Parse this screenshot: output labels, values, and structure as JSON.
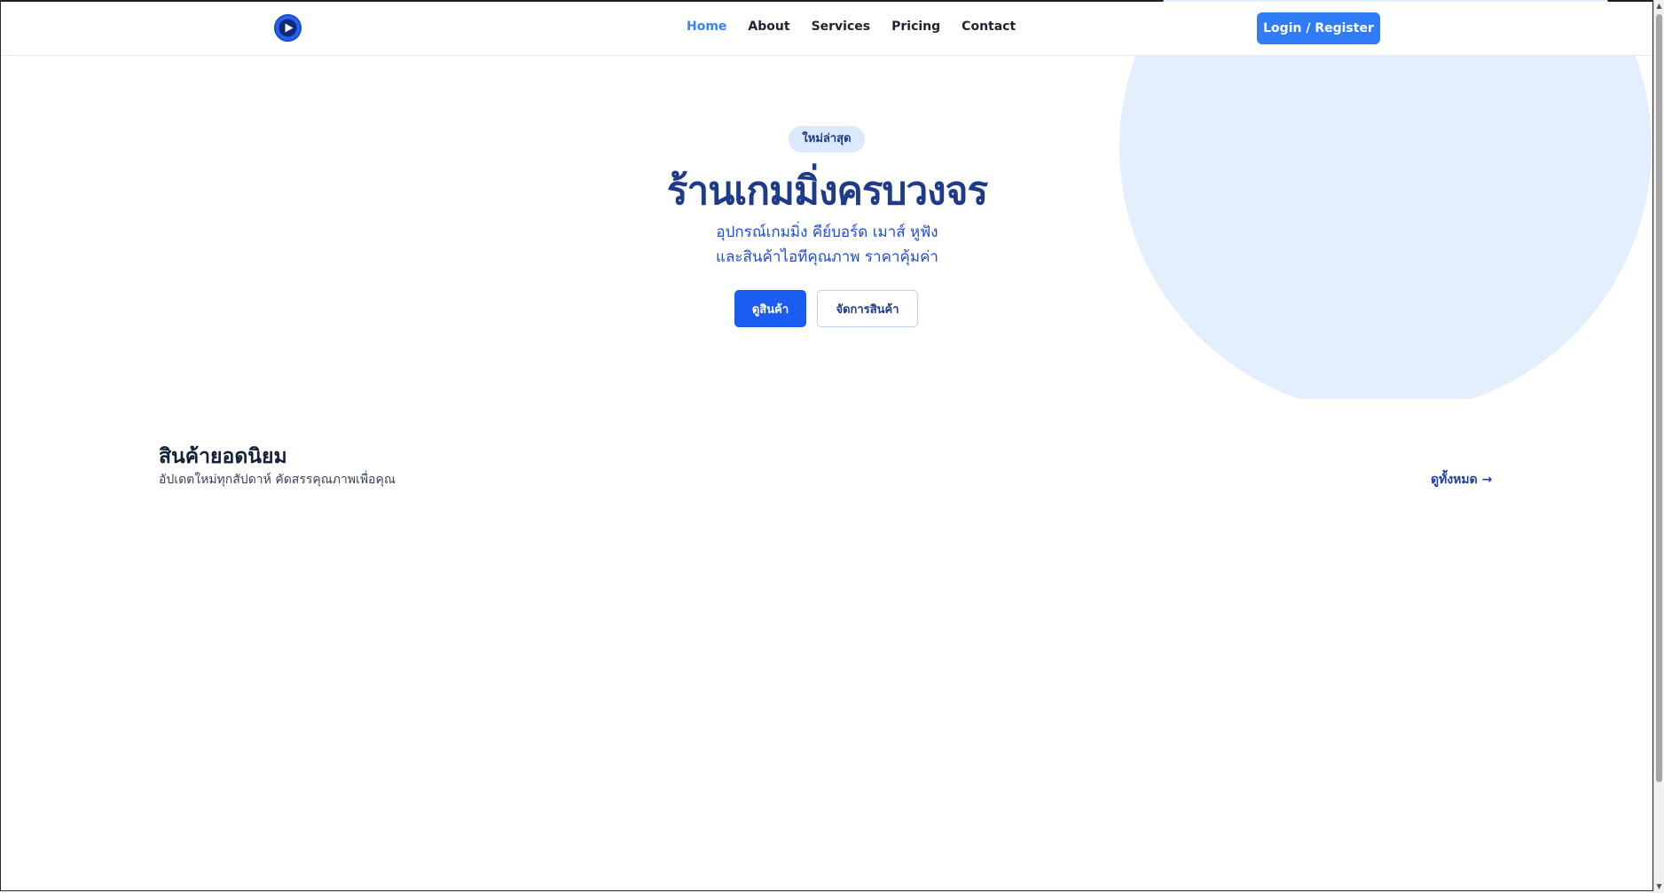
{
  "header": {
    "logo_icon": "play-circle-icon",
    "nav": [
      {
        "label": "Home",
        "active": true
      },
      {
        "label": "About",
        "active": false
      },
      {
        "label": "Services",
        "active": false
      },
      {
        "label": "Pricing",
        "active": false
      },
      {
        "label": "Contact",
        "active": false
      }
    ],
    "login_label": "Login / Register"
  },
  "hero": {
    "badge": "ใหม่ล่าสุด",
    "title": "ร้านเกมมิ่งครบวงจร",
    "subtitle_line1": "อุปกรณ์เกมมิ่ง คีย์บอร์ด เมาส์ หูฟัง",
    "subtitle_line2": "และสินค้าไอทีคุณภาพ ราคาคุ้มค่า",
    "primary_button": "ดูสินค้า",
    "secondary_button": "จัดการสินค้า"
  },
  "section": {
    "title": "สินค้ายอดนิยม",
    "subtitle": "อัปเดตใหม่ทุกสัปดาห์ คัดสรรคุณภาพเพื่อคุณ",
    "see_all": "ดูทั้งหมด →"
  },
  "colors": {
    "accent": "#2f7cf6",
    "primary_button": "#1a5cf0",
    "title": "#1e3a8a",
    "hero_circle": "#e3effd"
  }
}
